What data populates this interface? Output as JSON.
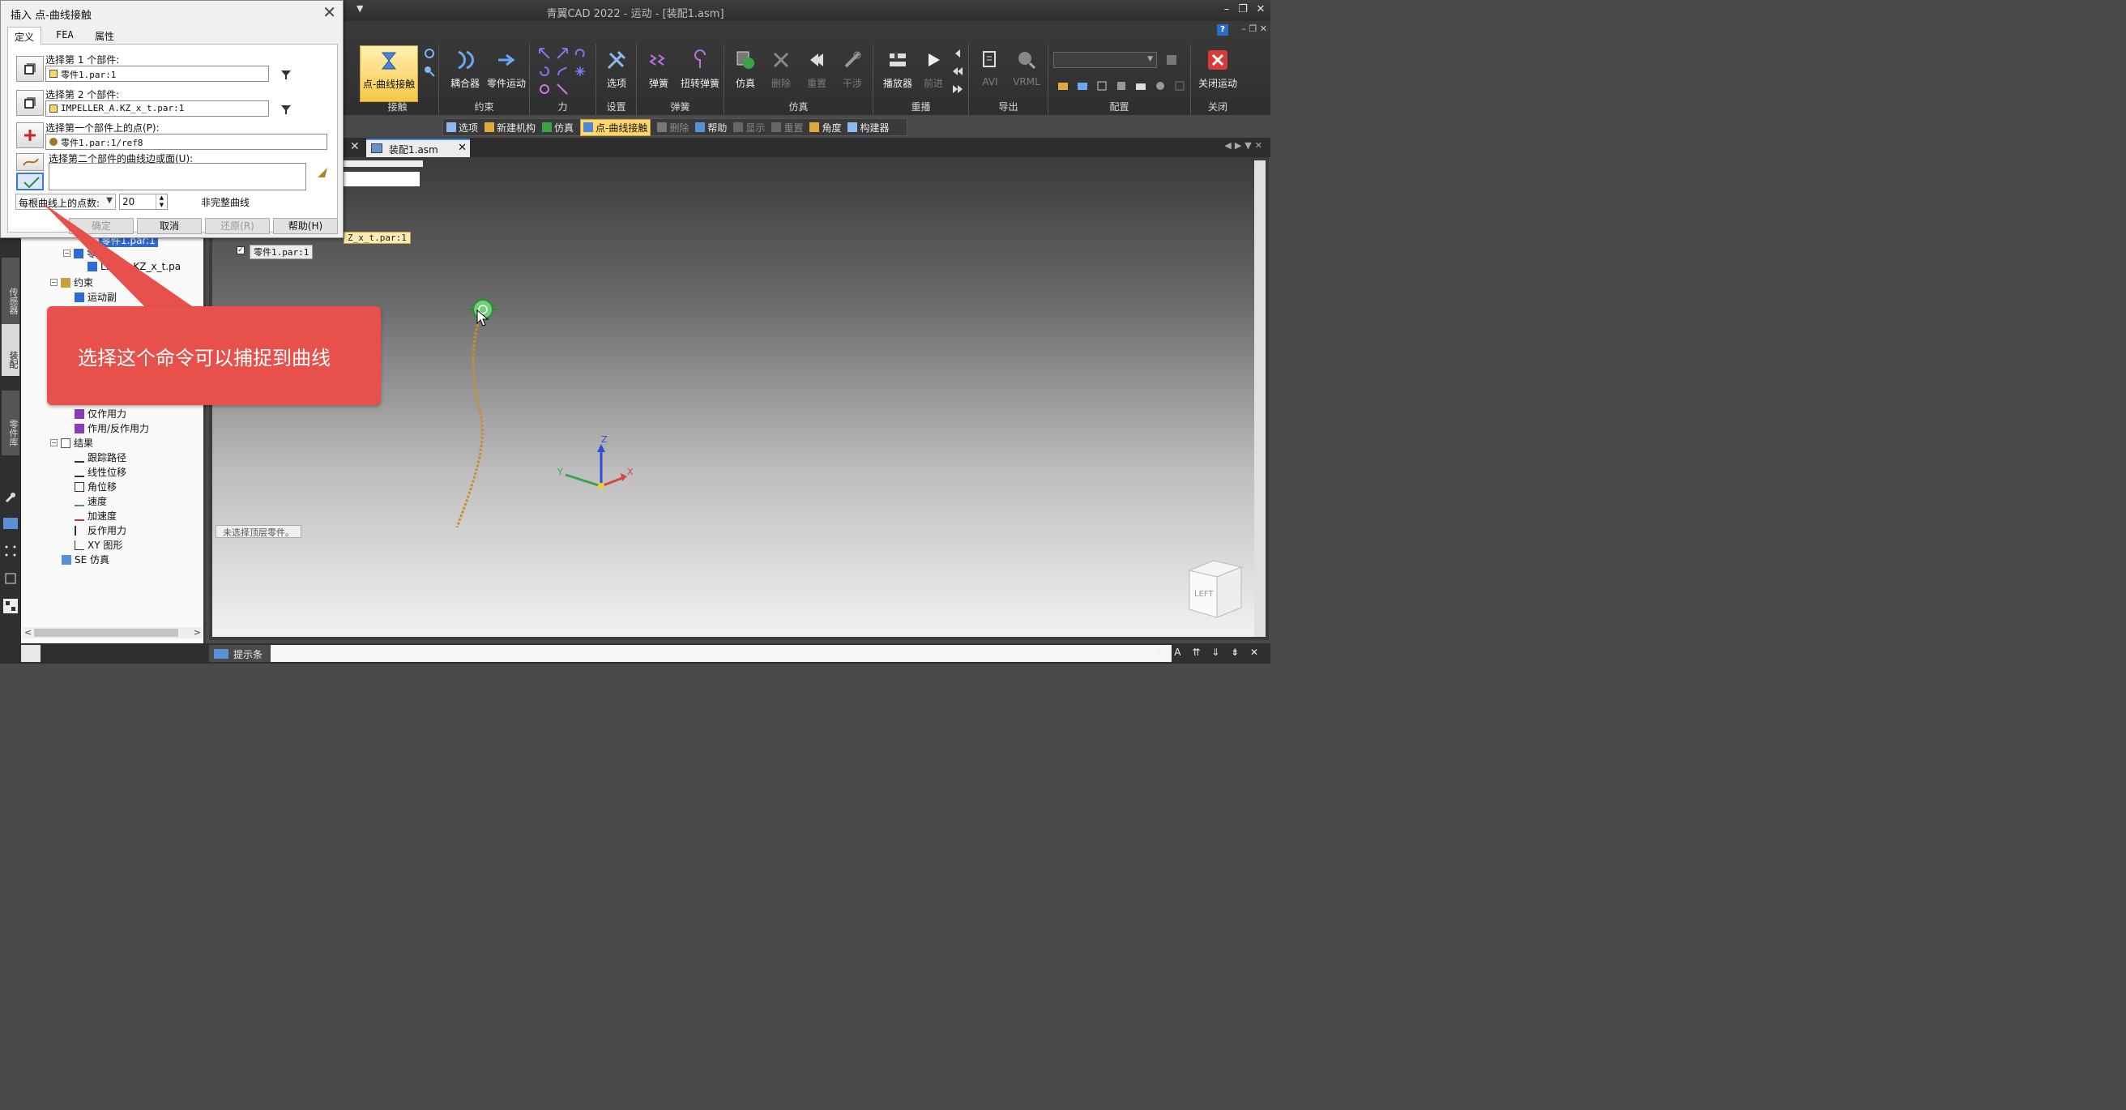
{
  "app": {
    "title": "青翼CAD 2022 - 运动 - [装配1.asm]"
  },
  "ribbon": {
    "groups": [
      {
        "label": "接触",
        "buttons": [
          {
            "label": "点-曲线接触",
            "icon": "point-curve-contact-icon",
            "active": true
          }
        ]
      },
      {
        "label": "约束",
        "buttons": [
          {
            "label": "耦合器",
            "icon": "coupler-icon"
          },
          {
            "label": "零件运动",
            "icon": "part-motion-icon"
          }
        ]
      },
      {
        "label": "力",
        "buttons": []
      },
      {
        "label": "设置",
        "buttons": [
          {
            "label": "选项",
            "icon": "options-icon"
          }
        ]
      },
      {
        "label": "弹簧",
        "buttons": [
          {
            "label": "弹簧",
            "icon": "spring-icon"
          },
          {
            "label": "扭转弹簧",
            "icon": "torsion-spring-icon"
          }
        ]
      },
      {
        "label": "仿真",
        "buttons": [
          {
            "label": "仿真",
            "icon": "simulate-icon"
          },
          {
            "label": "删除",
            "icon": "delete-icon",
            "disabled": true
          },
          {
            "label": "重置",
            "icon": "reset-icon",
            "disabled": true
          },
          {
            "label": "干涉",
            "icon": "interference-icon",
            "disabled": true
          }
        ]
      },
      {
        "label": "重播",
        "buttons": [
          {
            "label": "播放器",
            "icon": "player-icon"
          },
          {
            "label": "前进",
            "icon": "forward-icon",
            "disabled": true
          }
        ]
      },
      {
        "label": "导出",
        "buttons": [
          {
            "label": "AVI",
            "icon": "avi-icon",
            "disabled": true
          },
          {
            "label": "VRML",
            "icon": "vrml-icon",
            "disabled": true
          }
        ]
      },
      {
        "label": "配置",
        "buttons": []
      },
      {
        "label": "关闭",
        "buttons": [
          {
            "label": "关闭运动",
            "icon": "close-motion-icon"
          }
        ]
      }
    ]
  },
  "cmdbar": {
    "items": [
      {
        "label": "选项",
        "icon": "options-icon"
      },
      {
        "label": "新建机构",
        "icon": "new-mechanism-icon"
      },
      {
        "label": "仿真",
        "icon": "simulate-icon"
      },
      {
        "label": "点-曲线接触",
        "icon": "point-curve-contact-icon",
        "active": true
      },
      {
        "label": "删除",
        "icon": "delete-icon",
        "disabled": true
      },
      {
        "label": "帮助",
        "icon": "help-icon"
      },
      {
        "label": "显示",
        "icon": "display-icon",
        "disabled": true
      },
      {
        "label": "重置",
        "icon": "reset-icon",
        "disabled": true
      },
      {
        "label": "角度",
        "icon": "angle-icon"
      },
      {
        "label": "构建器",
        "icon": "builder-icon"
      }
    ]
  },
  "doc_tab": {
    "label": "装配1.asm"
  },
  "dialog": {
    "title": "插入 点-曲线接触",
    "tabs": [
      "定义",
      "FEA",
      "属性"
    ],
    "step1_label": "选择第 1 个部件:",
    "step1_value": "零件1.par:1",
    "step2_label": "选择第 2 个部件:",
    "step2_value": "IMPELLER_A.KZ_x_t.par:1",
    "point_label": "选择第一个部件上的点(P):",
    "point_value": "零件1.par:1/ref8",
    "curve_label": "选择第二个部件的曲线边或面(U):",
    "curve_value": "",
    "points_per_curve_label": "每根曲线上的点数:",
    "points_per_curve_value": "20",
    "incomplete_label": "非完整曲线",
    "buttons": {
      "ok": "确定",
      "cancel": "取消",
      "restore": "还原(R)",
      "help": "帮助(H)"
    }
  },
  "tree": {
    "items": [
      {
        "text": "零件1.par:1",
        "highlight": true
      },
      {
        "text": "零件"
      },
      {
        "text": "LER_A.KZ_x_t.pa"
      },
      {
        "text": "约束"
      },
      {
        "text": "运动副"
      },
      {
        "text": "仅作用力"
      },
      {
        "text": "作用/反作用力"
      },
      {
        "text": "结果"
      },
      {
        "text": "跟踪路径"
      },
      {
        "text": "线性位移"
      },
      {
        "text": "角位移"
      },
      {
        "text": "速度"
      },
      {
        "text": "加速度"
      },
      {
        "text": "反作用力"
      },
      {
        "text": "XY 图形"
      },
      {
        "text": "SE 仿真"
      }
    ]
  },
  "left_tabs": [
    "传感器",
    "装配",
    "零件库"
  ],
  "viewport": {
    "labels": [
      {
        "text": "Z_x_t.par:1"
      },
      {
        "text": "零件1.par:1"
      }
    ],
    "hint": "未选择顶层零件。",
    "viewcube_face": "LEFT",
    "triad_z": "Z",
    "triad_x": "X",
    "triad_y": "Y"
  },
  "callout": {
    "text": "选择这个命令可以捕捉到曲线"
  },
  "statusbar": {
    "prompt_label": "提示条"
  },
  "colors": {
    "accent": "#ffd66b",
    "callout": "#e8514b",
    "highlight": "#2f6bd6"
  }
}
